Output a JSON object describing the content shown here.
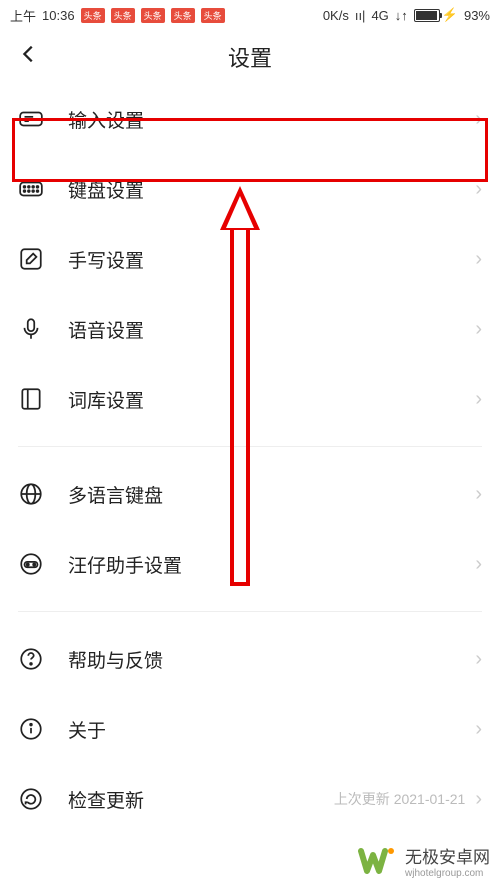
{
  "statusBar": {
    "timePrefix": "上午",
    "time": "10:36",
    "badges": [
      "头条",
      "头条",
      "头条",
      "头条",
      "头条"
    ],
    "speed": "0K/s",
    "network": "4G",
    "batteryPercent": "93%"
  },
  "header": {
    "title": "设置"
  },
  "groups": [
    {
      "items": [
        {
          "icon": "input-icon",
          "label": "输入设置"
        },
        {
          "icon": "keyboard-icon",
          "label": "键盘设置"
        },
        {
          "icon": "handwrite-icon",
          "label": "手写设置"
        },
        {
          "icon": "voice-icon",
          "label": "语音设置"
        },
        {
          "icon": "dictionary-icon",
          "label": "词库设置"
        }
      ]
    },
    {
      "items": [
        {
          "icon": "globe-icon",
          "label": "多语言键盘"
        },
        {
          "icon": "assistant-icon",
          "label": "汪仔助手设置"
        }
      ]
    },
    {
      "items": [
        {
          "icon": "help-icon",
          "label": "帮助与反馈"
        },
        {
          "icon": "about-icon",
          "label": "关于"
        },
        {
          "icon": "update-icon",
          "label": "检查更新",
          "extra": "上次更新 2021-01-21"
        }
      ]
    }
  ],
  "watermark": {
    "name": "无极安卓网",
    "url": "wjhotelgroup.com"
  }
}
